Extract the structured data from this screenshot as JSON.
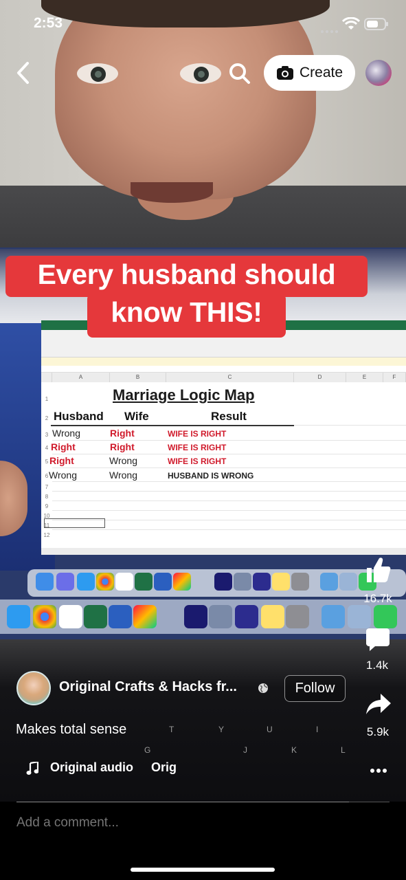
{
  "status_bar": {
    "time": "2:53"
  },
  "top_bar": {
    "create_label": "Create"
  },
  "video_caption": {
    "line1": "Every husband should",
    "line2": "know THIS!"
  },
  "spreadsheet": {
    "columns": [
      "A",
      "B",
      "C",
      "D",
      "E",
      "F"
    ],
    "title": "Marriage Logic Map",
    "headers": {
      "husband": "Husband",
      "wife": "Wife",
      "result": "Result"
    },
    "rows": [
      {
        "husband": "Wrong",
        "wife": "Right",
        "result": "WIFE IS RIGHT"
      },
      {
        "husband": "Right",
        "wife": "Right",
        "result": "WIFE IS RIGHT"
      },
      {
        "husband": "Right",
        "wife": "Wrong",
        "result": "WIFE IS RIGHT"
      },
      {
        "husband": "Wrong",
        "wife": "Wrong",
        "result": "HUSBAND IS WRONG"
      }
    ],
    "colors": {
      "red": "#d01a2b",
      "dark": "#222222",
      "excel_green": "#1f7145"
    }
  },
  "actions": {
    "likes": "16.7k",
    "comments": "1.4k",
    "shares": "5.9k"
  },
  "post": {
    "account_name": "Original Crafts & Hacks fr...",
    "follow_label": "Follow",
    "description": "Makes total sense",
    "audio_label": "Original audio",
    "audio_label_2": "Orig"
  },
  "comment": {
    "placeholder": "Add a comment..."
  },
  "theme": {
    "caption_red": "#e5383b",
    "background": "#000000"
  }
}
